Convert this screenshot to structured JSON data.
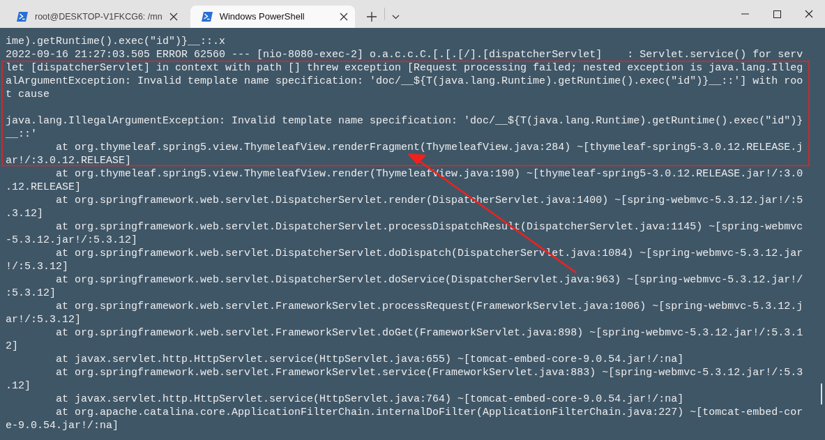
{
  "tabs": [
    {
      "title": "root@DESKTOP-V1FKCG6: /mn",
      "selected": false
    },
    {
      "title": "Windows PowerShell",
      "selected": true
    }
  ],
  "terminal": {
    "blocks": [
      [
        "ime).getRuntime().exec(\"id\")}__::.x",
        "2022-09-16 21:27:03.505 ERROR 62560 --- [nio-8080-exec-2] o.a.c.c.C.[.[.[/].[dispatcherServlet]    : Servlet.service() for serv",
        "let [dispatcherServlet] in context with path [] threw exception [Request processing failed; nested exception is java.lang.Illeg",
        "alArgumentException: Invalid template name specification: 'doc/__${T(java.lang.Runtime).getRuntime().exec(\"id\")}__::'] with roo",
        "t cause"
      ],
      [
        "java.lang.IllegalArgumentException: Invalid template name specification: 'doc/__${T(java.lang.Runtime).getRuntime().exec(\"id\")}",
        "__::'",
        "        at org.thymeleaf.spring5.view.ThymeleafView.renderFragment(ThymeleafView.java:284) ~[thymeleaf-spring5-3.0.12.RELEASE.j",
        "ar!/:3.0.12.RELEASE]",
        "        at org.thymeleaf.spring5.view.ThymeleafView.render(ThymeleafView.java:190) ~[thymeleaf-spring5-3.0.12.RELEASE.jar!/:3.0",
        ".12.RELEASE]",
        "        at org.springframework.web.servlet.DispatcherServlet.render(DispatcherServlet.java:1400) ~[spring-webmvc-5.3.12.jar!/:5",
        ".3.12]",
        "        at org.springframework.web.servlet.DispatcherServlet.processDispatchResult(DispatcherServlet.java:1145) ~[spring-webmvc",
        "-5.3.12.jar!/:5.3.12]",
        "        at org.springframework.web.servlet.DispatcherServlet.doDispatch(DispatcherServlet.java:1084) ~[spring-webmvc-5.3.12.jar",
        "!/:5.3.12]",
        "        at org.springframework.web.servlet.DispatcherServlet.doService(DispatcherServlet.java:963) ~[spring-webmvc-5.3.12.jar!/",
        ":5.3.12]",
        "        at org.springframework.web.servlet.FrameworkServlet.processRequest(FrameworkServlet.java:1006) ~[spring-webmvc-5.3.12.j",
        "ar!/:5.3.12]",
        "        at org.springframework.web.servlet.FrameworkServlet.doGet(FrameworkServlet.java:898) ~[spring-webmvc-5.3.12.jar!/:5.3.1",
        "2]",
        "        at javax.servlet.http.HttpServlet.service(HttpServlet.java:655) ~[tomcat-embed-core-9.0.54.jar!/:na]",
        "        at org.springframework.web.servlet.FrameworkServlet.service(FrameworkServlet.java:883) ~[spring-webmvc-5.3.12.jar!/:5.3",
        ".12]",
        "        at javax.servlet.http.HttpServlet.service(HttpServlet.java:764) ~[tomcat-embed-core-9.0.54.jar!/:na]",
        "        at org.apache.catalina.core.ApplicationFilterChain.internalDoFilter(ApplicationFilterChain.java:227) ~[tomcat-embed-cor",
        "e-9.0.54.jar!/:na]"
      ]
    ]
  }
}
